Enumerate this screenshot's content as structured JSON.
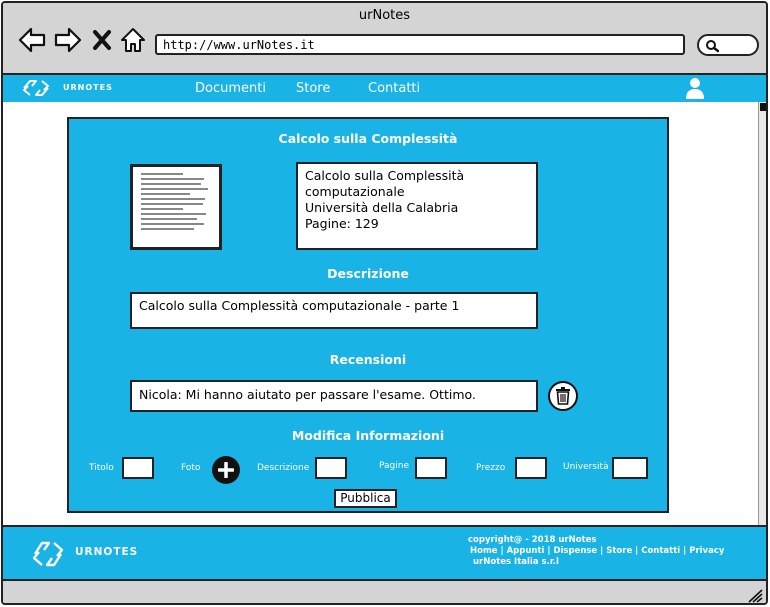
{
  "window": {
    "title": "urNotes",
    "url": "http://www.urNotes.it"
  },
  "navbar": {
    "logo": "URNOTES",
    "links": [
      "Documenti",
      "Store",
      "Contatti"
    ]
  },
  "document": {
    "title": "Calcolo sulla Complessità",
    "info_lines": [
      "Calcolo sulla Complessità",
      "computazionale",
      "Università della Calabria",
      "Pagine: 129"
    ],
    "description_heading": "Descrizione",
    "description": "Calcolo sulla Complessità computazionale - parte 1",
    "reviews_heading": "Recensioni",
    "review": "Nicola: Mi hanno aiutato per passare l'esame. Ottimo."
  },
  "edit": {
    "heading": "Modifica Informazioni",
    "fields": [
      "Titolo",
      "Foto",
      "Descrizione",
      "Pagine",
      "Prezzo",
      "Università"
    ],
    "publish_label": "Pubblica"
  },
  "footer": {
    "logo": "URNOTES",
    "copyright": "copyright@ - 2018 urNotes",
    "links": "Home | Appunti | Dispense | Store | Contatti | Privacy",
    "company": "urNotes Italia s.r.l"
  },
  "colors": {
    "accent": "#1ab3e6",
    "chrome": "#d4d4d4"
  },
  "icons": [
    "back-arrow-icon",
    "forward-arrow-icon",
    "close-icon",
    "home-icon",
    "search-icon",
    "recycle-logo-icon",
    "user-icon",
    "trash-icon",
    "plus-icon",
    "resize-grip-icon"
  ]
}
